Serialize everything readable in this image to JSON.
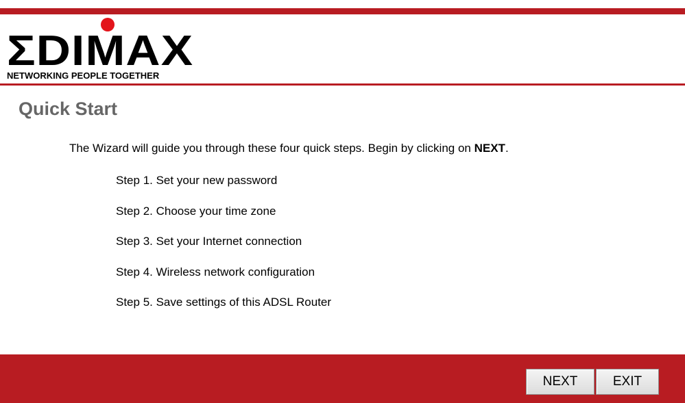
{
  "header": {
    "logo_word": "ΣDIMAX",
    "logo_tagline": "NETWORKING PEOPLE TOGETHER"
  },
  "main": {
    "title": "Quick Start",
    "intro_prefix": "The Wizard will guide you through these four quick steps. Begin by clicking on ",
    "intro_bold": "NEXT",
    "intro_suffix": ".",
    "steps": [
      "Step 1. Set your new password",
      "Step 2. Choose your time zone",
      "Step 3. Set your Internet connection",
      "Step 4. Wireless network configuration",
      "Step 5. Save settings of this ADSL Router"
    ]
  },
  "footer": {
    "next_label": "NEXT",
    "exit_label": "EXIT"
  },
  "colors": {
    "brand_red": "#b81c22",
    "logo_dot": "#e3141b",
    "title_gray": "#666666"
  }
}
